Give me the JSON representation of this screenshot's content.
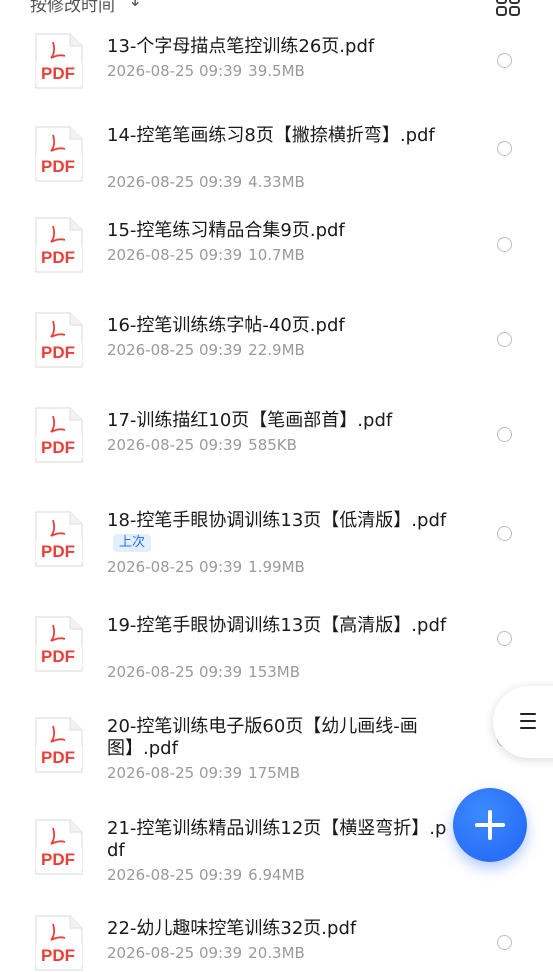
{
  "sortbar": {
    "label": "按修改时间",
    "arrow": "↓",
    "view_toggle_icon": "grid-icon"
  },
  "files": [
    {
      "name": "13-个字母描点笔控训练26页.pdf",
      "date": "2026-08-25 09:39",
      "size": "39.5MB",
      "badge": "",
      "icon": "pdf-file-icon"
    },
    {
      "name": "14-控笔笔画练习8页【撇捺横折弯】.pdf",
      "date": "2026-08-25 09:39",
      "size": "4.33MB",
      "badge": "",
      "icon": "pdf-file-icon"
    },
    {
      "name": "15-控笔练习精品合集9页.pdf",
      "date": "2026-08-25 09:39",
      "size": "10.7MB",
      "badge": "",
      "icon": "pdf-file-icon"
    },
    {
      "name": "16-控笔训练练字帖-40页.pdf",
      "date": "2026-08-25 09:39",
      "size": "22.9MB",
      "badge": "",
      "icon": "pdf-file-icon"
    },
    {
      "name": "17-训练描红10页【笔画部首】.pdf",
      "date": "2026-08-25 09:39",
      "size": "585KB",
      "badge": "",
      "icon": "pdf-file-icon"
    },
    {
      "name": "18-控笔手眼协调训练13页【低清版】.pdf",
      "date": "2026-08-25 09:39",
      "size": "1.99MB",
      "badge": "上次",
      "icon": "pdf-file-icon"
    },
    {
      "name": "19-控笔手眼协调训练13页【高清版】.pdf",
      "date": "2026-08-25 09:39",
      "size": "153MB",
      "badge": "",
      "icon": "pdf-file-icon"
    },
    {
      "name": "20-控笔训练电子版60页【幼儿画线-画图】.pdf",
      "date": "2026-08-25 09:39",
      "size": "175MB",
      "badge": "",
      "icon": "pdf-file-icon"
    },
    {
      "name": "21-控笔训练精品训练12页【横竖弯折】.pdf",
      "date": "2026-08-25 09:39",
      "size": "6.94MB",
      "badge": "",
      "icon": "pdf-file-icon"
    },
    {
      "name": "22-幼儿趣味控笔训练32页.pdf",
      "date": "2026-08-25 09:39",
      "size": "20.3MB",
      "badge": "",
      "icon": "pdf-file-icon"
    }
  ],
  "pdf_label": "PDF",
  "colors": {
    "pdf_red": "#e8413a",
    "accent_blue": "#2b6fe8",
    "fab_blue": "#1f63f5"
  },
  "side_menu_icon": "hamburger-icon",
  "fab_icon": "plus-icon"
}
